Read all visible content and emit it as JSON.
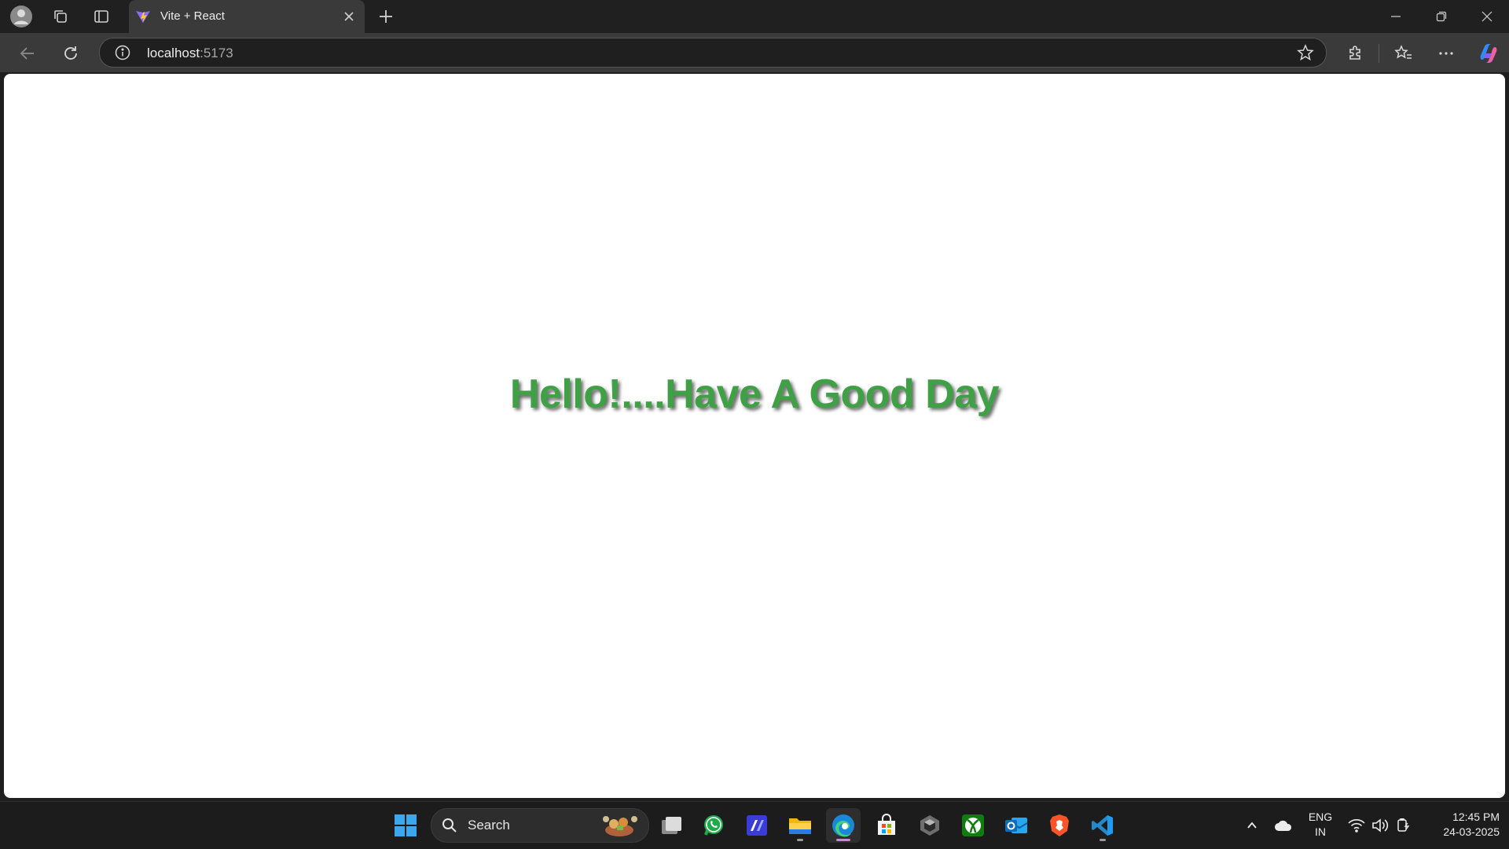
{
  "browser": {
    "tab": {
      "title": "Vite + React"
    },
    "address": {
      "host": "localhost",
      "port": ":5173"
    }
  },
  "page": {
    "greeting": "Hello!....Have A Good Day",
    "text_color": "#3fa046"
  },
  "taskbar": {
    "search_label": "Search",
    "language": {
      "line1": "ENG",
      "line2": "IN"
    },
    "clock": {
      "time": "12:45 PM",
      "date": "24-03-2025"
    }
  },
  "icons": [
    "profile-icon",
    "workspaces-icon",
    "vertical-tabs-icon",
    "vite-icon",
    "close-icon",
    "new-tab-icon",
    "minimize-icon",
    "restore-icon",
    "window-close-icon",
    "back-icon",
    "refresh-icon",
    "info-icon",
    "favorite-star-icon",
    "extensions-icon",
    "favorites-icon",
    "more-icon",
    "copilot-icon",
    "windows-start-icon",
    "search-icon",
    "task-view-icon",
    "whatsapp-icon",
    "edit-app-icon",
    "file-explorer-icon",
    "edge-icon",
    "microsoft-store-icon",
    "unity-icon",
    "xbox-icon",
    "outlook-icon",
    "brave-icon",
    "vscode-icon",
    "chevron-up-icon",
    "onedrive-icon",
    "wifi-icon",
    "volume-icon",
    "battery-icon"
  ]
}
